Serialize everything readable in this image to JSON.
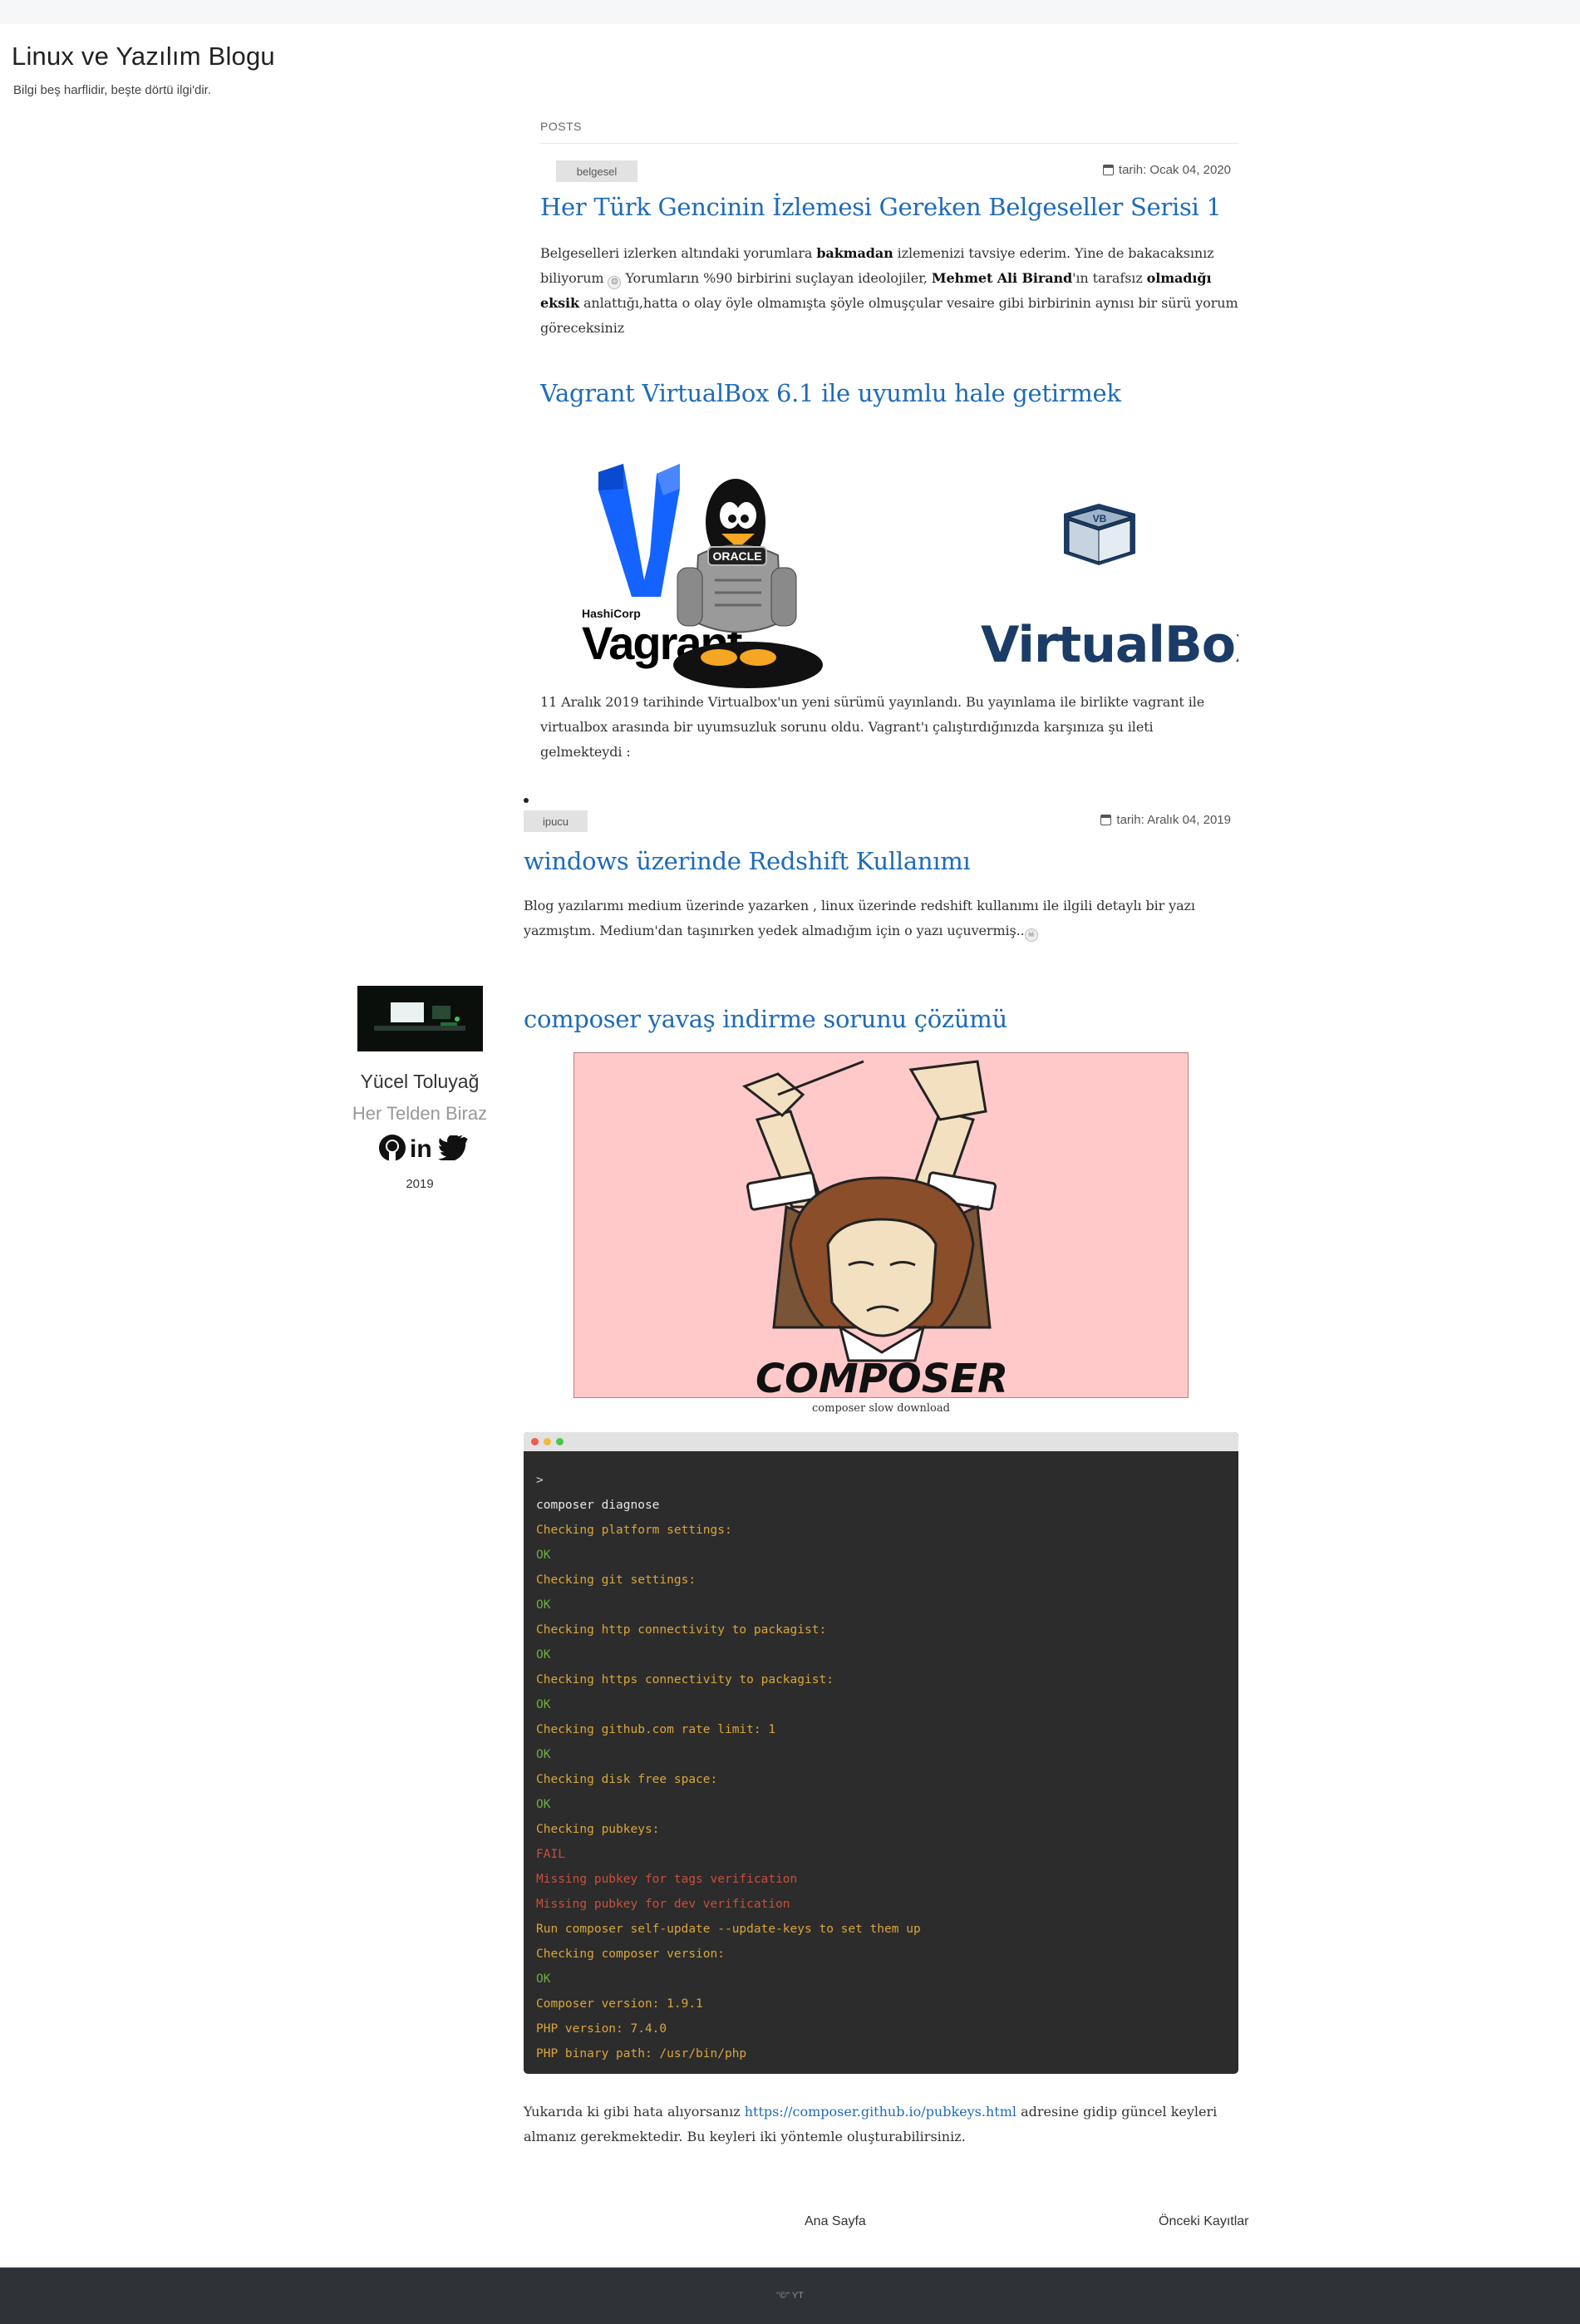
{
  "site": {
    "title": "Linux ve Yazılım Blogu",
    "tagline": "Bilgi beş harflidir, beşte dörtü ilgi'dir."
  },
  "posts_label": "POSTS",
  "posts": [
    {
      "tag": "belgesel",
      "date": "tarih: Ocak 04, 2020",
      "title": "Her Türk Gencinin İzlemesi Gereken Belgeseller Serisi 1",
      "excerpt": {
        "p1": "Belgeselleri izlerken altındaki yorumlara ",
        "b1": "bakmadan",
        "p2": " izlemenizi tavsiye ederim. Yine de bakacaksınız biliyorum ",
        "p3": " Yorumların %90 birbirini suçlayan ideolojiler, ",
        "b2": "Mehmet Ali Birand",
        "p4": "'ın tarafsız ",
        "b3": "olmadığı eksik",
        "p5": " anlattığı,hatta o olay öyle olmamışta şöyle olmuşçular vesaire gibi birbirinin aynısı bir sürü yorum göreceksiniz"
      }
    },
    {
      "title": "Vagrant VirtualBox 6.1 ile uyumlu hale getirmek",
      "hero": {
        "vagrant_company": "HashiCorp",
        "vagrant_name": "Vagrant",
        "oracle_badge": "ORACLE",
        "virtualbox_name": "VirtualBox",
        "vb_cube_label": "VB"
      },
      "excerpt": "11 Aralık 2019 tarihinde Virtualbox'un yeni sürümü yayınlandı. Bu yayınlama ile birlikte vagrant ile virtualbox arasında bir uyumsuzluk sorunu oldu.  Vagrant'ı çalıştırdığınızda karşınıza şu ileti gelmekteydi :"
    },
    {
      "tag": "ipucu",
      "date": "tarih: Aralık 04, 2019",
      "title": "windows üzerinde Redshift Kullanımı",
      "excerpt": "Blog yazılarımı medium üzerinde yazarken , linux üzerinde redshift kullanımı ile ilgili detaylı bir yazı yazmıştım. Medium'dan taşınırken yedek almadığım için o yazı uçuvermiş.."
    },
    {
      "title": "composer yavaş indirme sorunu çözümü",
      "image_text": "COMPOSER",
      "caption": "composer slow download",
      "terminal": [
        {
          "text": ">",
          "color": "#cfcfcf"
        },
        {
          "text": "composer diagnose",
          "color": "#e8e8e8"
        },
        {
          "text": "Checking platform settings:",
          "color": "#d9a63c"
        },
        {
          "text": "OK",
          "color": "#6fae3e"
        },
        {
          "text": "Checking git settings:",
          "color": "#d9a63c"
        },
        {
          "text": "OK",
          "color": "#6fae3e"
        },
        {
          "text": "Checking http connectivity to packagist:",
          "color": "#d9a63c"
        },
        {
          "text": "OK",
          "color": "#6fae3e"
        },
        {
          "text": "Checking https connectivity to packagist:",
          "color": "#d9a63c"
        },
        {
          "text": "OK",
          "color": "#6fae3e"
        },
        {
          "text": "Checking github.com rate limit: 1",
          "color": "#d9a63c"
        },
        {
          "text": "OK",
          "color": "#6fae3e"
        },
        {
          "text": "Checking disk free space:",
          "color": "#d9a63c"
        },
        {
          "text": "OK",
          "color": "#6fae3e"
        },
        {
          "text": "Checking pubkeys:",
          "color": "#d9a63c"
        },
        {
          "text": "FAIL",
          "color": "#c8503c"
        },
        {
          "text": "Missing pubkey for tags verification",
          "color": "#c8503c"
        },
        {
          "text": "Missing pubkey for dev verification",
          "color": "#c8503c"
        },
        {
          "text": "Run composer self-update --update-keys to set them up",
          "color": "#d9a63c"
        },
        {
          "text": "Checking composer version:",
          "color": "#d9a63c"
        },
        {
          "text": "OK",
          "color": "#6fae3e"
        },
        {
          "text": "Composer version: 1.9.1",
          "color": "#d9a63c"
        },
        {
          "text": "PHP version: 7.4.0",
          "color": "#d9a63c"
        },
        {
          "text": "PHP binary path: /usr/bin/php",
          "color": "#d9a63c"
        }
      ],
      "after": {
        "before_link": "Yukarıda ki gibi hata alıyorsanız ",
        "link": "https://composer.github.io/pubkeys.html",
        "after_link": " adresine gidip güncel keyleri almanız gerekmektedir. Bu keyleri iki yöntemle oluşturabilirsiniz."
      }
    }
  ],
  "author": {
    "name": "Yücel Toluyağ",
    "subtitle": "Her Telden Biraz",
    "year": "2019",
    "socials": [
      "github-icon",
      "linkedin-icon",
      "twitter-icon"
    ],
    "linkedin_text": "in"
  },
  "pagination": {
    "home": "Ana Sayfa",
    "older": "Önceki Kayıtlar"
  },
  "footer": "\"©\" YT",
  "colors": {
    "link": "#1e6bb8",
    "footer_bg": "#2f3237",
    "terminal_bg": "#2c2c2c",
    "terminal_ok": "#6fae3e",
    "terminal_warn": "#d9a63c",
    "terminal_fail": "#c8503c"
  }
}
